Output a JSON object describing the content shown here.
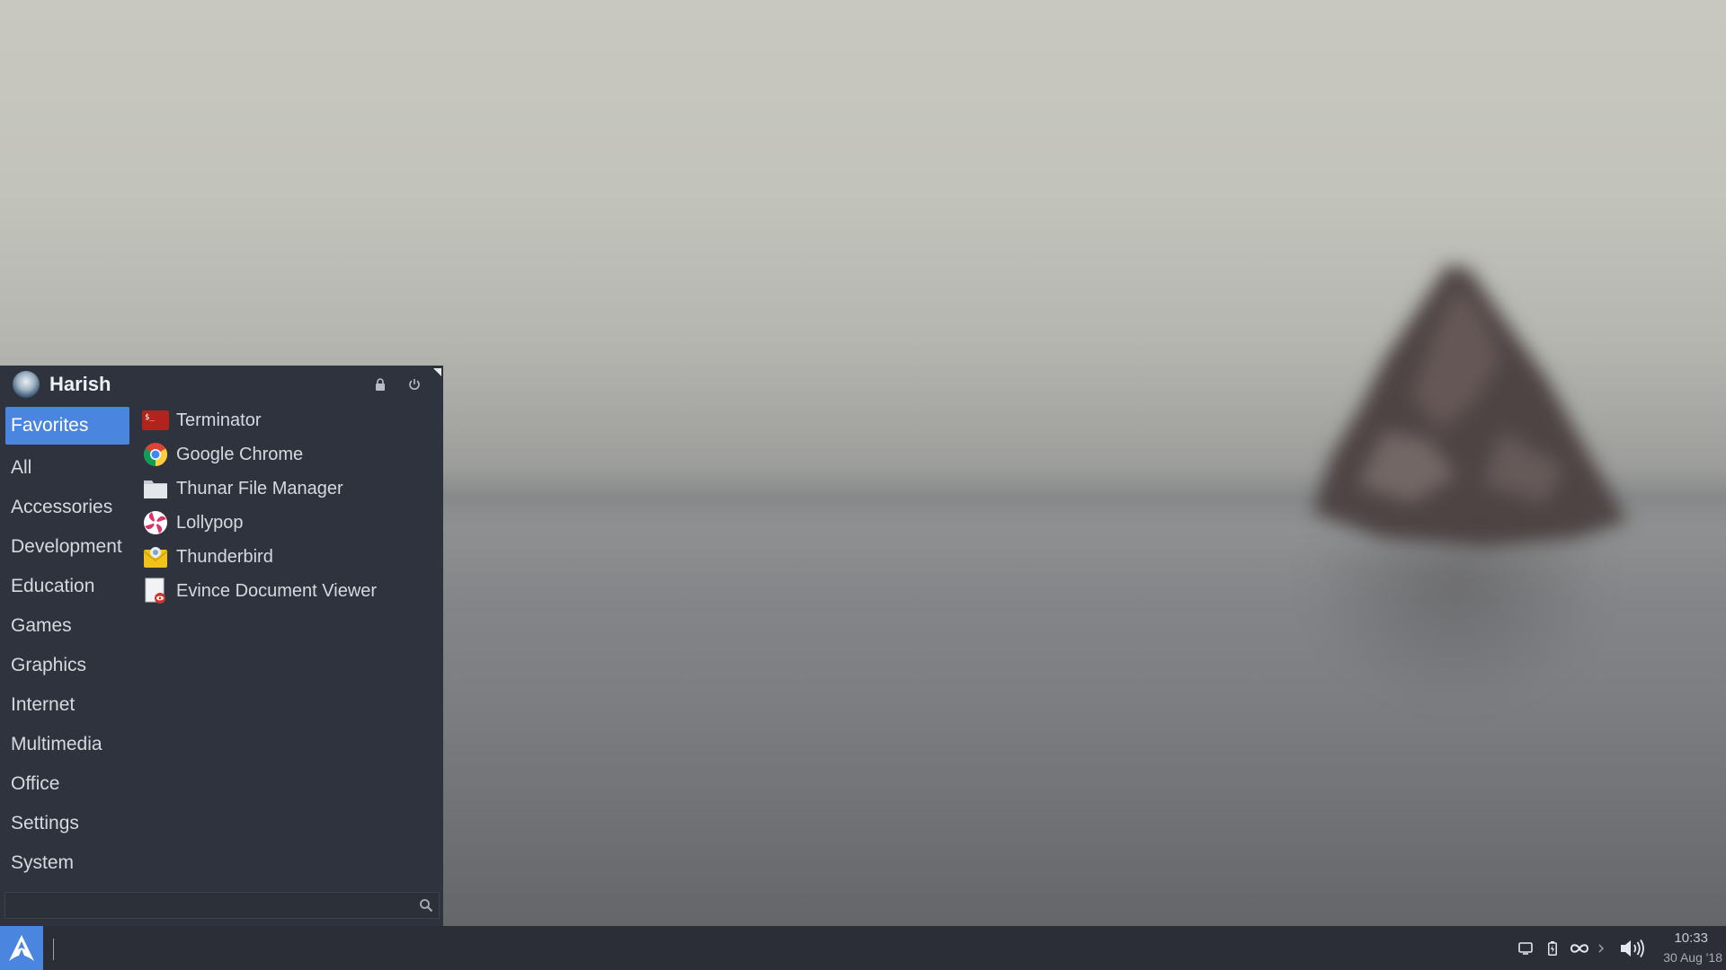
{
  "user": {
    "name": "Harish"
  },
  "header_buttons": [
    {
      "name": "lock-screen",
      "icon": "lock-icon"
    },
    {
      "name": "log-out",
      "icon": "power-icon"
    }
  ],
  "categories": [
    {
      "label": "Favorites",
      "active": true
    },
    {
      "label": "All"
    },
    {
      "label": "Accessories"
    },
    {
      "label": "Development"
    },
    {
      "label": "Education"
    },
    {
      "label": "Games"
    },
    {
      "label": "Graphics"
    },
    {
      "label": "Internet"
    },
    {
      "label": "Multimedia"
    },
    {
      "label": "Office"
    },
    {
      "label": "Settings"
    },
    {
      "label": "System"
    }
  ],
  "favorites": [
    {
      "label": "Terminator",
      "icon": "terminal-icon"
    },
    {
      "label": "Google Chrome",
      "icon": "chrome-icon"
    },
    {
      "label": "Thunar File Manager",
      "icon": "folder-icon"
    },
    {
      "label": "Lollypop",
      "icon": "lollypop-icon"
    },
    {
      "label": "Thunderbird",
      "icon": "thunderbird-icon"
    },
    {
      "label": "Evince Document Viewer",
      "icon": "document-viewer-icon"
    }
  ],
  "search": {
    "value": "",
    "placeholder": ""
  },
  "panel": {
    "clock_time": "10:33",
    "clock_date": "30 Aug '18",
    "tray_icons": [
      "display-icon",
      "battery-icon",
      "infinity-icon",
      "chevron-right-icon",
      "volume-icon"
    ]
  },
  "colors": {
    "accent": "#4a86e0",
    "menu_bg": "#2f333d",
    "panel_bg": "#2b2e37"
  }
}
